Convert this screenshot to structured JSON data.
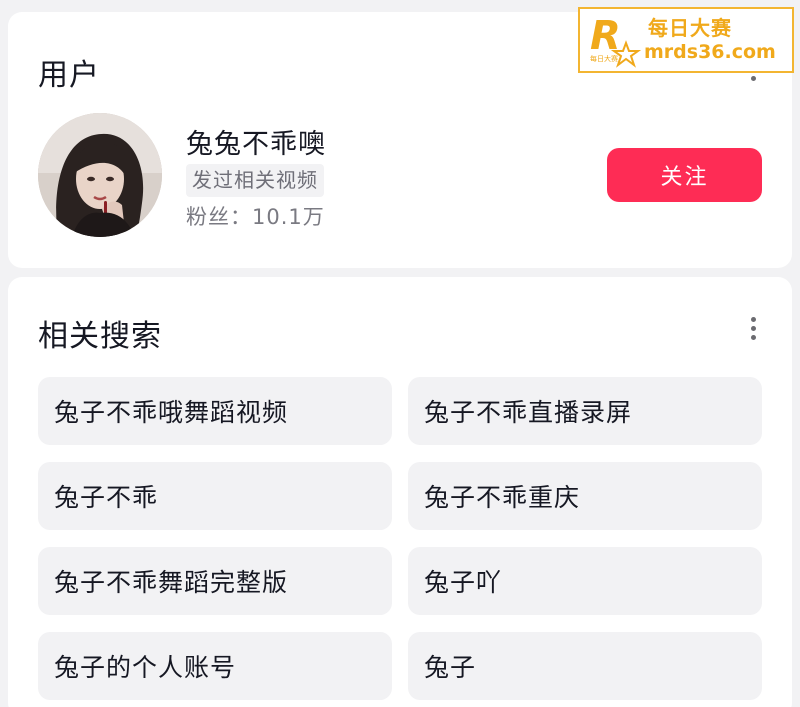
{
  "user_section": {
    "title": "用户",
    "user": {
      "name": "兔兔不乖噢",
      "tag": "发过相关视频",
      "fans_label": "粉丝：",
      "fans_count": "10.1万"
    },
    "follow_label": "关注",
    "more_icon": "more-vertical-icon"
  },
  "search_section": {
    "title": "相关搜索",
    "more_icon": "more-vertical-icon",
    "items": [
      "兔子不乖哦舞蹈视频",
      "兔子不乖直播录屏",
      "兔子不乖",
      "兔子不乖重庆",
      "兔子不乖舞蹈完整版",
      "兔子吖",
      "兔子的个人账号",
      "兔子"
    ]
  },
  "watermark": {
    "logo_letter": "R",
    "logo_small_text": "每日大赛",
    "cn_text": "每日大赛",
    "url_text": "mrds36.com"
  },
  "colors": {
    "accent": "#fe2c55",
    "watermark": "#f0a91b",
    "chip_bg": "#f2f2f4"
  }
}
